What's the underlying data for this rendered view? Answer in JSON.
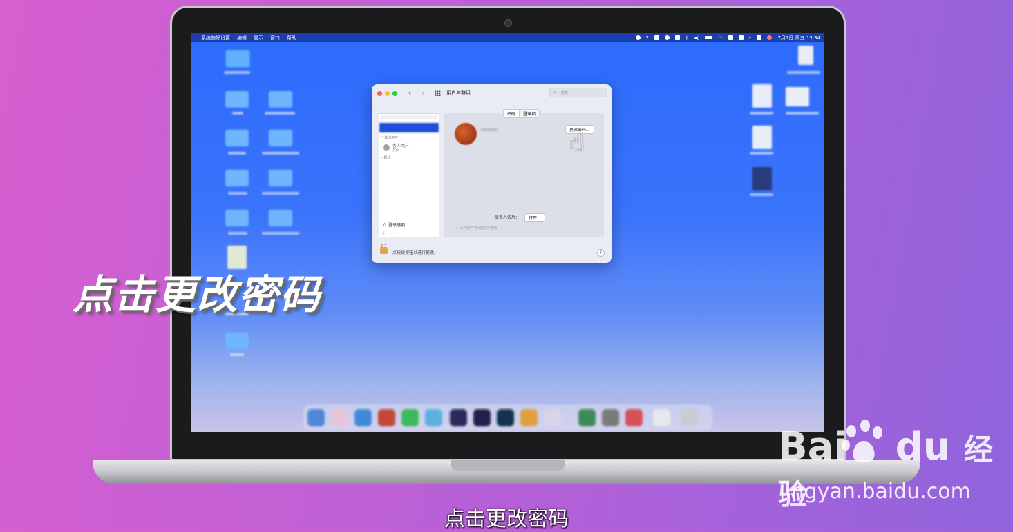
{
  "menubar": {
    "apple": "",
    "app": "系统偏好设置",
    "edit": "编辑",
    "view": "显示",
    "window": "窗口",
    "help": "帮助",
    "tray_badge": "2",
    "clock": "7月1日 周五 13:34"
  },
  "window": {
    "title": "用户与群组",
    "search_placeholder": "搜索",
    "back": "‹",
    "forward": "›",
    "tabs": [
      "密码",
      "登录项"
    ],
    "sidebar": {
      "other_users": "其他用户",
      "guest_user": "客人用户",
      "guest_status": "关闭",
      "groups": "群组",
      "login_options": "登录选项",
      "add": "+",
      "remove": "−"
    },
    "change_password_button": "更改密码...",
    "contact_card_label": "联系人名片：",
    "open_button": "打开...",
    "allow_admin": "允许用户管理这台电脑",
    "lock_text": "点按锁按钮以进行更改。",
    "help": "?"
  },
  "overlay": {
    "caption": "点击更改密码",
    "subtitle": "点击更改密码"
  },
  "watermark": {
    "brand": "Bai",
    "brand2": "du",
    "cn": "经验",
    "url": "jingyan.baidu.com"
  },
  "colors": {
    "background_left": "#d85fcf",
    "background_right": "#8f64dc",
    "desktop_blue": "#2d6bfd",
    "selection": "#1f4fd6"
  }
}
